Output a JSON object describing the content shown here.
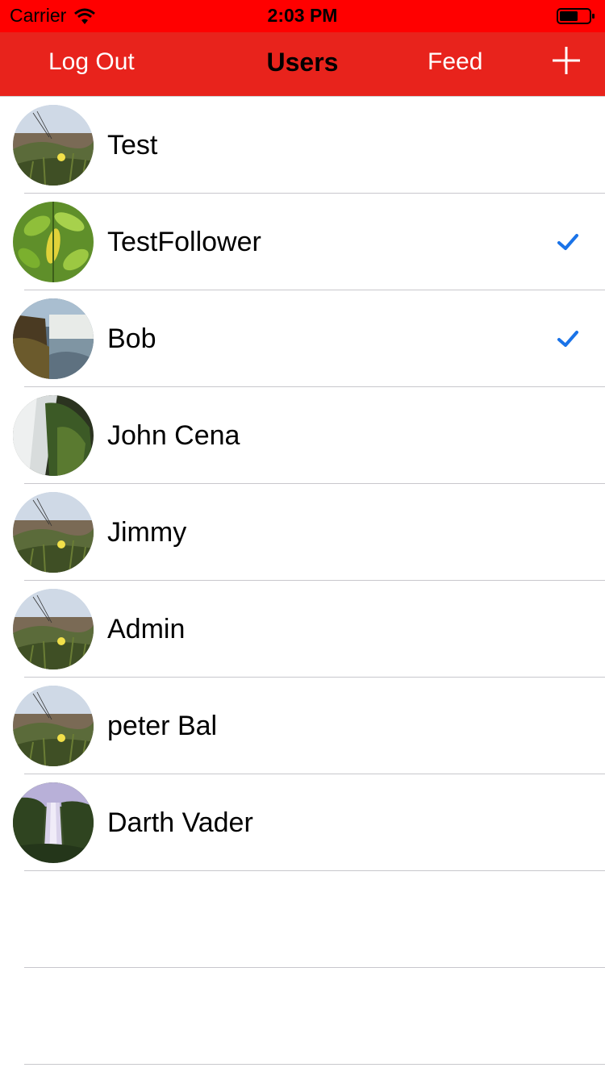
{
  "status_bar": {
    "carrier": "Carrier",
    "time": "2:03 PM",
    "color": "#ff0000"
  },
  "nav": {
    "left_label": "Log Out",
    "title": "Users",
    "feed_label": "Feed",
    "add_icon": "plus-icon",
    "color": "#e8231c"
  },
  "users": [
    {
      "name": "Test",
      "following": false,
      "avatar": "meadow-flower-photo"
    },
    {
      "name": "TestFollower",
      "following": true,
      "avatar": "green-leaves-photo"
    },
    {
      "name": "Bob",
      "following": true,
      "avatar": "waterfall-cliff-photo"
    },
    {
      "name": "John Cena",
      "following": false,
      "avatar": "waterfall-mossy-rock-photo"
    },
    {
      "name": "Jimmy",
      "following": false,
      "avatar": "meadow-flower-photo"
    },
    {
      "name": "Admin",
      "following": false,
      "avatar": "meadow-flower-photo"
    },
    {
      "name": "peter Bal",
      "following": false,
      "avatar": "meadow-flower-photo"
    },
    {
      "name": "Darth Vader",
      "following": false,
      "avatar": "tall-waterfall-photo"
    }
  ],
  "check_color": "#1a73e8"
}
